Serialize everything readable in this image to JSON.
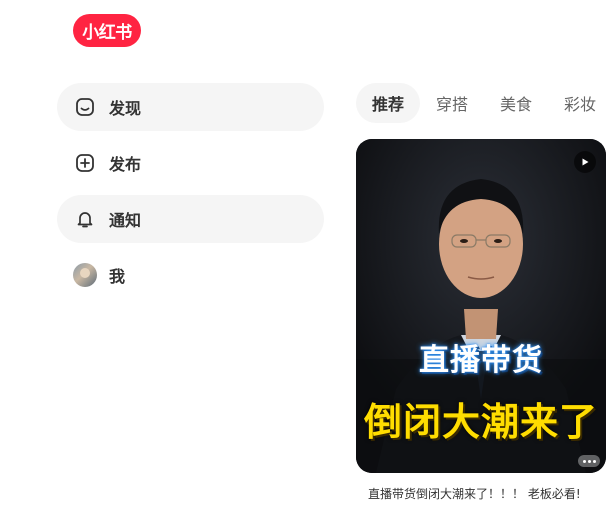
{
  "brand": {
    "logo_text": "小红书",
    "color": "#ff2442"
  },
  "sidebar": {
    "items": [
      {
        "label": "发现",
        "icon": "home-icon",
        "active": true
      },
      {
        "label": "发布",
        "icon": "plus-square-icon",
        "active": false
      },
      {
        "label": "通知",
        "icon": "bell-icon",
        "active": true
      },
      {
        "label": "我",
        "icon": "avatar",
        "active": false
      }
    ]
  },
  "tabs": [
    {
      "label": "推荐",
      "active": true
    },
    {
      "label": "穿搭",
      "active": false
    },
    {
      "label": "美食",
      "active": false
    },
    {
      "label": "彩妆",
      "active": false
    }
  ],
  "feed": {
    "card": {
      "overlay_line1": "直播带货",
      "overlay_line2": "倒闭大潮来了",
      "play_icon": "play-icon",
      "caption": "直播带货倒闭大潮来了！！！ 老板必看!"
    }
  }
}
